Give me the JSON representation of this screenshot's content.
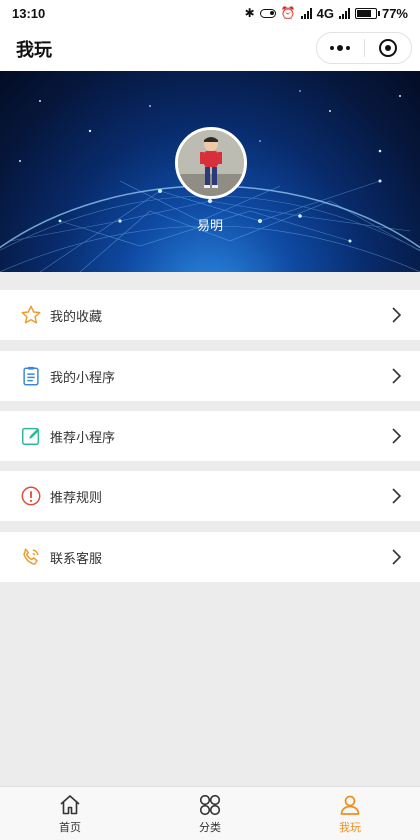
{
  "status_bar": {
    "time": "13:10",
    "network": "4G",
    "battery": "77%",
    "battery_level": 0.77
  },
  "nav": {
    "title": "我玩"
  },
  "profile": {
    "name": "易明"
  },
  "menu": [
    {
      "label": "我的收藏",
      "icon": "star-icon",
      "color": "#ef9a2a"
    },
    {
      "label": "我的小程序",
      "icon": "clipboard-icon",
      "color": "#3b87d6"
    },
    {
      "label": "推荐小程序",
      "icon": "edit-icon",
      "color": "#2fb89a"
    },
    {
      "label": "推荐规则",
      "icon": "alert-icon",
      "color": "#e14b3b"
    },
    {
      "label": "联系客服",
      "icon": "phone-icon",
      "color": "#ef9a2a"
    }
  ],
  "tabs": [
    {
      "label": "首页",
      "icon": "home-icon",
      "active": false
    },
    {
      "label": "分类",
      "icon": "grid-icon",
      "active": false
    },
    {
      "label": "我玩",
      "icon": "user-icon",
      "active": true
    }
  ],
  "colors": {
    "accent": "#ef8f1b",
    "background": "#ececec"
  }
}
